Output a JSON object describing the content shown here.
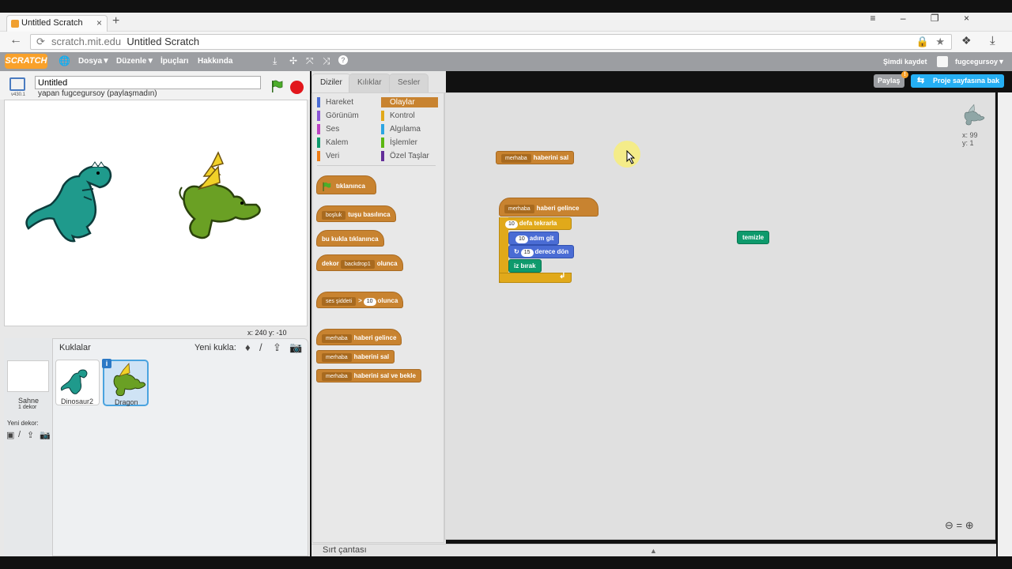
{
  "browser": {
    "tab_title": "Untitled Scratch",
    "tab_close": "×",
    "new_tab": "+",
    "window_controls": "≡ – ❐ ×",
    "back": "←",
    "url_host": "scratch.mit.edu",
    "url_title": "Untitled Scratch",
    "reload": "⟳",
    "lock": "🔒",
    "star": "★"
  },
  "menubar": {
    "logo": "SCRATCH",
    "globe": "🌐",
    "file": "Dosya▼",
    "edit": "Düzenle▼",
    "tips": "İpuçları",
    "about": "Hakkında",
    "tools": [
      "⤓",
      "✢",
      "⤧",
      "⤨",
      "?"
    ],
    "save_now": "Şimdi kaydet",
    "username": "fugcegursoy▼"
  },
  "stage": {
    "project_name": "Untitled",
    "version": "v430.1",
    "author": "yapan fugcegursoy (paylaşmadın)",
    "coords": "x: 240  y: -10"
  },
  "sprites_pane": {
    "title": "Kuklalar",
    "new_sprite": "Yeni kukla:",
    "new_sprite_icons": [
      "♦",
      "/",
      "⇪",
      "📷"
    ],
    "stage_label": "Sahne",
    "stage_backdrops": "1 dekor",
    "new_backdrop": "Yeni dekor:",
    "new_backdrop_icons": [
      "▣",
      "/",
      "⇪",
      "📷"
    ],
    "info": "i",
    "sprites": [
      {
        "name": "Dinosaur2"
      },
      {
        "name": "Dragon",
        "selected": true
      }
    ]
  },
  "tabs": [
    "Diziler",
    "Kılıklar",
    "Sesler"
  ],
  "categories": {
    "left": [
      {
        "label": "Hareket",
        "color": "#4a6cd4"
      },
      {
        "label": "Görünüm",
        "color": "#8a55d7"
      },
      {
        "label": "Ses",
        "color": "#bb42c3"
      },
      {
        "label": "Kalem",
        "color": "#0e9a6c"
      },
      {
        "label": "Veri",
        "color": "#ee7d16"
      }
    ],
    "right": [
      {
        "label": "Olaylar",
        "color": "#c88330",
        "selected": true
      },
      {
        "label": "Kontrol",
        "color": "#e1a91a"
      },
      {
        "label": "Algılama",
        "color": "#2ca5e2"
      },
      {
        "label": "İşlemler",
        "color": "#5cb712"
      },
      {
        "label": "Özel Taşlar",
        "color": "#632d99"
      }
    ]
  },
  "palette_blocks": {
    "flag_clicked": "tıklanınca",
    "key_dd": "boşluk",
    "key_tail": "tuşu basılınca",
    "sprite_clicked": "bu kukla tıklanınca",
    "backdrop_head": "dekor",
    "backdrop_dd": "backdrop1",
    "backdrop_tail": "olunca",
    "loudness_dd": "ses şiddeti",
    "loudness_op": ">",
    "loudness_val": "10",
    "loudness_tail": "olunca",
    "recv_dd": "merhaba",
    "recv_tail": "haberi gelince",
    "bcast_dd": "merhaba",
    "bcast_tail": "haberini sal",
    "bcastw_dd": "merhaba",
    "bcastw_tail": "haberini sal ve bekle"
  },
  "script_area": {
    "broadcast_dd": "merhaba",
    "broadcast_tail": "haberini sal",
    "hat_dd": "merhaba",
    "hat_tail": "haberi gelince",
    "repeat_count": "10",
    "repeat_label": "defa tekrarla",
    "move_steps": "10",
    "move_label": "adım git",
    "turn_icon": "↻",
    "turn_degrees": "15",
    "turn_label": "derece dön",
    "pen_down": "iz bırak",
    "loop_arrow": "↲",
    "clear_block": "temizle",
    "sprite_x": "x: 99",
    "sprite_y": "y: 1",
    "zoom_out": "⊖",
    "zoom_reset": "=",
    "zoom_in": "⊕"
  },
  "buttons": {
    "share": "Paylaş",
    "project_page": "Proje sayfasına bak",
    "project_page_icon": "⇆"
  },
  "backpack": {
    "label": "Sırt çantası",
    "arrow": "▲"
  }
}
